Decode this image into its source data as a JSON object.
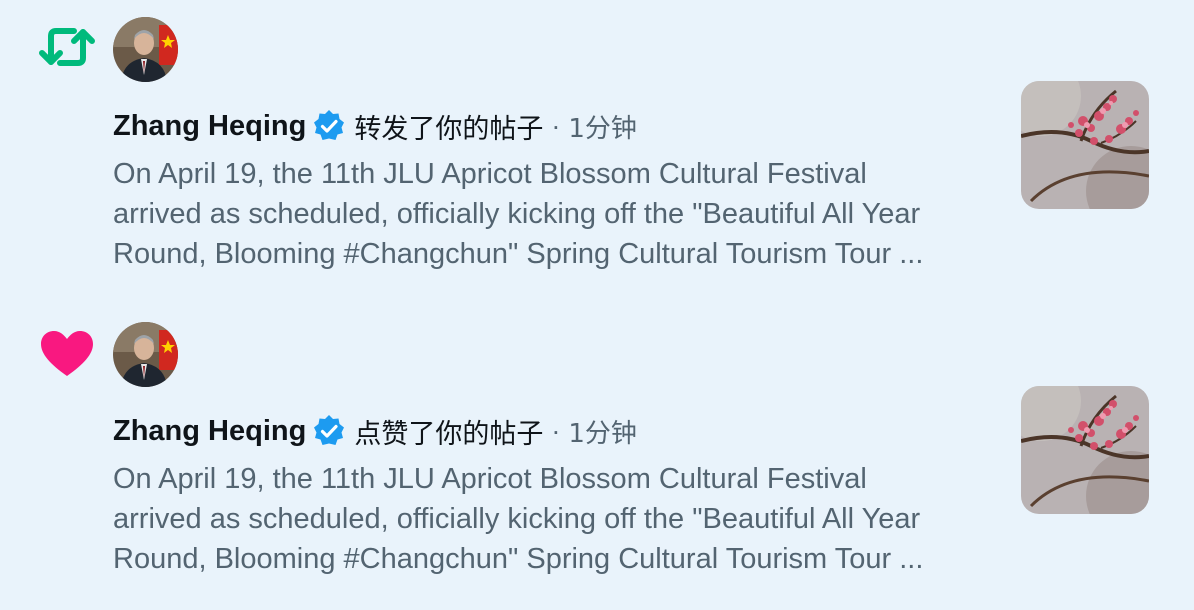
{
  "colors": {
    "background": "#e9f3fb",
    "retweet_green": "#00ba7c",
    "like_pink": "#f91880",
    "verified_blue": "#1d9bf0",
    "secondary_text": "#536471"
  },
  "notifications": [
    {
      "kind_icon": "retweet-icon",
      "author": "Zhang Heqing",
      "action": "转发了你的帖子",
      "separator": "·",
      "time": "1分钟",
      "lines": [
        "On April 19, the 11th JLU Apricot Blossom Cultural Festival",
        "arrived as scheduled, officially kicking off the \"Beautiful All Year",
        "Round, Blooming #Changchun\" Spring Cultural Tourism Tour ..."
      ]
    },
    {
      "kind_icon": "heart-icon",
      "author": "Zhang Heqing",
      "action": "点赞了你的帖子",
      "separator": "·",
      "time": "1分钟",
      "lines": [
        "On April 19, the 11th JLU Apricot Blossom Cultural Festival",
        "arrived as scheduled, officially kicking off the \"Beautiful All Year",
        "Round, Blooming #Changchun\" Spring Cultural Tourism Tour ..."
      ]
    }
  ]
}
